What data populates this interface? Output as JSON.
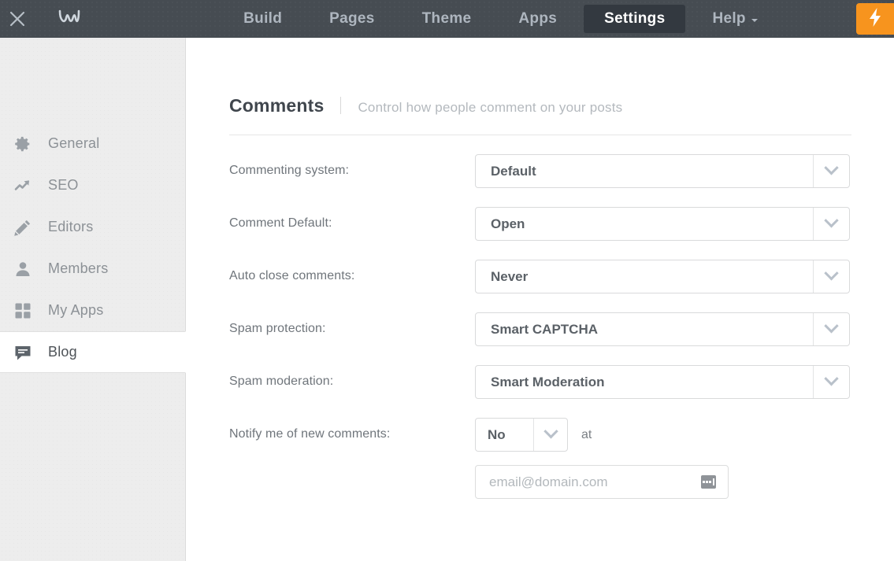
{
  "topbar": {
    "close_icon": "close-icon",
    "logo_icon": "weebly-logo-icon",
    "nav": [
      {
        "label": "Build",
        "active": false,
        "has_caret": false
      },
      {
        "label": "Pages",
        "active": false,
        "has_caret": false
      },
      {
        "label": "Theme",
        "active": false,
        "has_caret": false
      },
      {
        "label": "Apps",
        "active": false,
        "has_caret": false
      },
      {
        "label": "Settings",
        "active": true,
        "has_caret": false
      },
      {
        "label": "Help",
        "active": false,
        "has_caret": true
      }
    ],
    "publish_icon": "lightning-bolt-icon",
    "publish_color": "#f7941e",
    "background_color": "#464c52",
    "active_tab_color": "#333940"
  },
  "sidebar": {
    "items": [
      {
        "label": "General",
        "icon": "gear-icon",
        "active": false
      },
      {
        "label": "SEO",
        "icon": "trend-arrow-icon",
        "active": false
      },
      {
        "label": "Editors",
        "icon": "pencil-icon",
        "active": false
      },
      {
        "label": "Members",
        "icon": "person-icon",
        "active": false
      },
      {
        "label": "My Apps",
        "icon": "grid-apps-icon",
        "active": false
      },
      {
        "label": "Blog",
        "icon": "speech-bubble-icon",
        "active": true
      }
    ],
    "background_color": "#ededed"
  },
  "main": {
    "title": "Comments",
    "subtitle": "Control how people comment on your posts",
    "fields": [
      {
        "label": "Commenting system:",
        "value": "Default",
        "control": "select",
        "width": "wide"
      },
      {
        "label": "Comment Default:",
        "value": "Open",
        "control": "select",
        "width": "wide"
      },
      {
        "label": "Auto close comments:",
        "value": "Never",
        "control": "select",
        "width": "wide"
      },
      {
        "label": "Spam protection:",
        "value": "Smart CAPTCHA",
        "control": "select",
        "width": "wide"
      },
      {
        "label": "Spam moderation:",
        "value": "Smart Moderation",
        "control": "select",
        "width": "wide"
      }
    ],
    "notify": {
      "label": "Notify me of new comments:",
      "value": "No",
      "at_text": "at",
      "email_value": "",
      "email_placeholder": "email@domain.com",
      "autofill_icon": "autofill-icon"
    }
  }
}
